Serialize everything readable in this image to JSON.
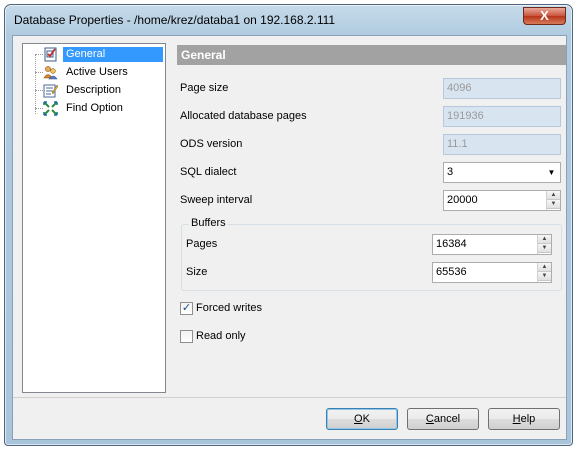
{
  "window": {
    "title": "Database Properties - /home/krez/databa1 on 192.168.2.111",
    "close_glyph": "X"
  },
  "nav": {
    "items": [
      {
        "label": "General",
        "icon": "general-checklist-icon",
        "selected": true
      },
      {
        "label": "Active Users",
        "icon": "users-icon",
        "selected": false
      },
      {
        "label": "Description",
        "icon": "description-icon",
        "selected": false
      },
      {
        "label": "Find Option",
        "icon": "find-option-icon",
        "selected": false
      }
    ]
  },
  "general": {
    "header": "General",
    "page_size_label": "Page size",
    "page_size": "4096",
    "allocated_pages_label": "Allocated database pages",
    "allocated_pages": "191936",
    "ods_version_label": "ODS version",
    "ods_version": "11.1",
    "sql_dialect_label": "SQL dialect",
    "sql_dialect": "3",
    "sweep_interval_label": "Sweep interval",
    "sweep_interval": "20000"
  },
  "buffers": {
    "title": "Buffers",
    "pages_label": "Pages",
    "pages": "16384",
    "size_label": "Size",
    "size": "65536"
  },
  "options": {
    "forced_writes_label": "Forced writes",
    "forced_writes": true,
    "read_only_label": "Read only",
    "read_only": false
  },
  "buttons": {
    "ok_mnemonic": "O",
    "ok_rest": "K",
    "cancel_mnemonic": "C",
    "cancel_rest": "ancel",
    "help_mnemonic": "H",
    "help_rest": "elp"
  },
  "colors": {
    "selection": "#3399ff",
    "header_bg": "#a2a2a2",
    "disabled_field_bg": "#d8e4f0"
  }
}
